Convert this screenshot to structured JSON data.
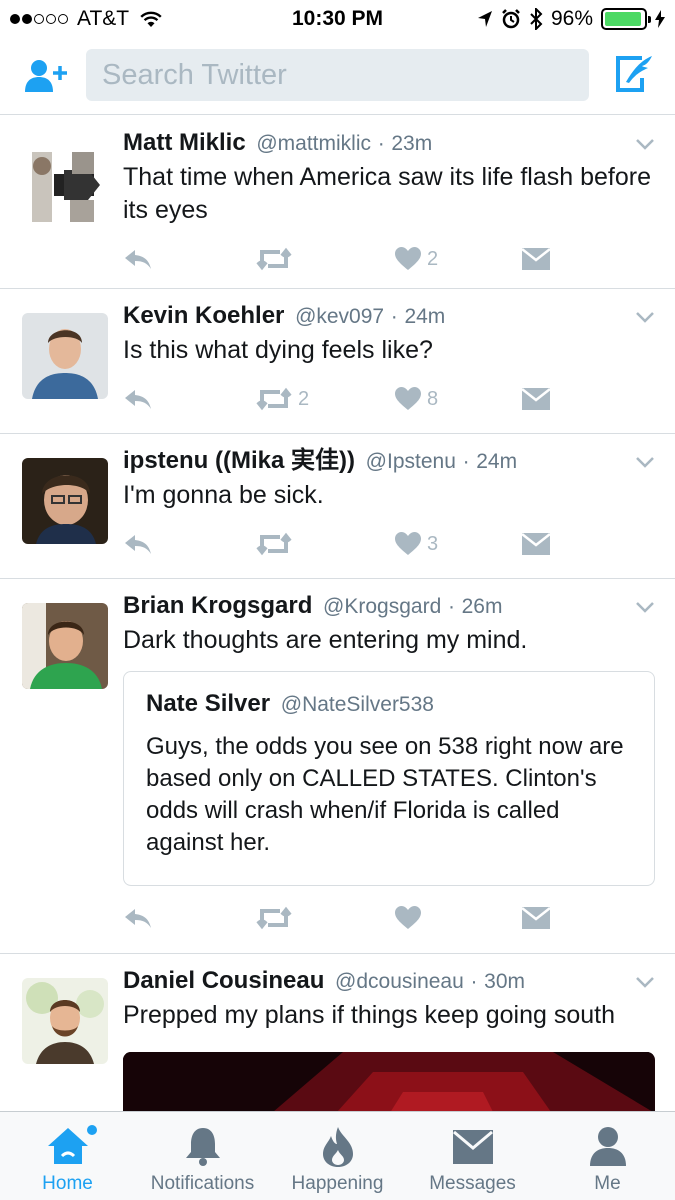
{
  "status": {
    "carrier": "AT&T",
    "time": "10:30 PM",
    "battery": "96%",
    "battery_level": 0.96
  },
  "search": {
    "placeholder": "Search Twitter"
  },
  "tweets": [
    {
      "name": "Matt Miklic",
      "handle": "@mattmiklic",
      "time": "23m",
      "text": "That time when America saw its life flash before its eyes",
      "retweets": "",
      "likes": "2"
    },
    {
      "name": "Kevin Koehler",
      "handle": "@kev097",
      "time": "24m",
      "text": "Is this what dying feels like?",
      "retweets": "2",
      "likes": "8"
    },
    {
      "name": "ipstenu ((Mika 実佳))",
      "handle": "@Ipstenu",
      "time": "24m",
      "text": "I'm gonna be sick.",
      "retweets": "",
      "likes": "3"
    },
    {
      "name": "Brian Krogsgard",
      "handle": "@Krogsgard",
      "time": "26m",
      "text": "Dark thoughts are entering my mind.",
      "retweets": "",
      "likes": "",
      "quote": {
        "name": "Nate Silver",
        "handle": "@NateSilver538",
        "text": "Guys, the odds you see on 538 right now are based only on CALLED STATES. Clinton's odds will crash when/if Florida is called against her."
      }
    },
    {
      "name": "Daniel Cousineau",
      "handle": "@dcousineau",
      "time": "30m",
      "text": "Prepped my plans if things keep going south"
    }
  ],
  "separator": "·",
  "tabs": [
    {
      "label": "Home",
      "icon": "home-icon",
      "active": true
    },
    {
      "label": "Notifications",
      "icon": "bell-icon"
    },
    {
      "label": "Happening",
      "icon": "flame-icon"
    },
    {
      "label": "Messages",
      "icon": "envelope-icon"
    },
    {
      "label": "Me",
      "icon": "person-icon"
    }
  ],
  "colors": {
    "accent": "#1da1f2",
    "secondary_text": "#657786",
    "action_icon": "#aab8c2",
    "battery": "#4cd964"
  }
}
